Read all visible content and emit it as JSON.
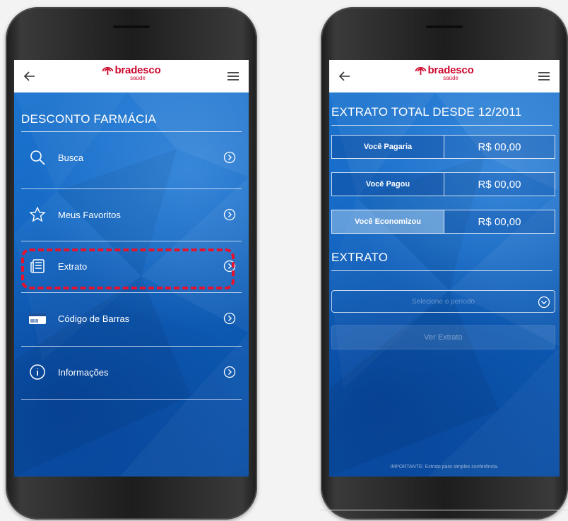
{
  "brand": {
    "name": "bradesco",
    "sub": "saúde",
    "color": "#cc092f"
  },
  "left_screen": {
    "title": "DESCONTO FARMÁCIA",
    "menu": [
      {
        "label": "Busca",
        "icon": "search-icon"
      },
      {
        "label": "Meus Favoritos",
        "icon": "star-icon"
      },
      {
        "label": "Extrato",
        "icon": "statement-icon"
      },
      {
        "label": "Código de Barras",
        "icon": "barcode-card-icon"
      },
      {
        "label": "Informações",
        "icon": "info-icon"
      }
    ],
    "highlighted_item": "Extrato",
    "highlight_color": "#e5122e"
  },
  "right_screen": {
    "title": "EXTRATO TOTAL DESDE 12/2011",
    "rows": [
      {
        "label": "Você Pagaria",
        "value": "R$ 00,00"
      },
      {
        "label": "Você Pagou",
        "value": "R$ 00,00"
      },
      {
        "label": "Você Economizou",
        "value": "R$ 00,00"
      }
    ],
    "section_title": "EXTRATO",
    "period_placeholder": "Selecione o período",
    "view_button": "Ver Extrato",
    "footnote": "IMPORTANTE: Extrato para simples conferência."
  }
}
